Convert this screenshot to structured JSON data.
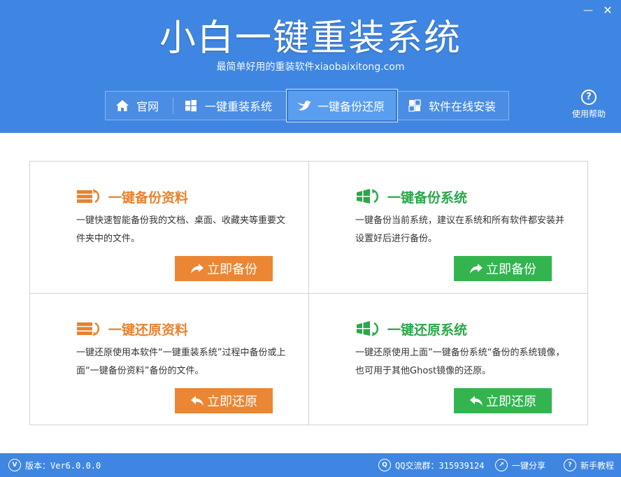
{
  "window": {
    "title": "小白一键重装系统",
    "subtitle": "最简单好用的重装软件xiaobaixitong.com",
    "controls": {
      "minimize": "—",
      "close": "✕"
    }
  },
  "nav": {
    "tabs": [
      {
        "label": "官网",
        "icon": "home-icon"
      },
      {
        "label": "一键重装系统",
        "icon": "windows-icon"
      },
      {
        "label": "一键备份还原",
        "icon": "bird-icon",
        "active": true
      },
      {
        "label": "软件在线安装",
        "icon": "apps-icon"
      }
    ]
  },
  "help": {
    "icon": "?",
    "label": "使用帮助"
  },
  "cards": [
    {
      "title": "一键备份资料",
      "icon": "drive-icon",
      "desc": "一键快速智能备份我的文档、桌面、收藏夹等重要文件夹中的文件。",
      "button": "立即备份",
      "color": "#ea8634"
    },
    {
      "title": "一键备份系统",
      "icon": "windows-flag-icon",
      "desc": "一键备份当前系统，建议在系统和所有软件都安装并设置好后进行备份。",
      "button": "立即备份",
      "color": "#33b44f"
    },
    {
      "title": "一键还原资料",
      "icon": "drive-icon",
      "desc": "一键还原使用本软件“一键重装系统”过程中备份或上面“一键备份资料”备份的文件。",
      "button": "立即还原",
      "color": "#ea8634"
    },
    {
      "title": "一键还原系统",
      "icon": "windows-flag-icon",
      "desc": "一键还原使用上面”一键备份系统“备份的系统镜像，也可用于其他Ghost镜像的还原。",
      "button": "立即还原",
      "color": "#33b44f"
    }
  ],
  "footer": {
    "version": "版本：Ver6.0.0.0",
    "qq": "QQ交流群：315939124",
    "share": "一键分享",
    "tutorial": "新手教程"
  },
  "colors": {
    "primary": "#3f86e2",
    "orange": "#ea8634",
    "green": "#33b44f"
  }
}
